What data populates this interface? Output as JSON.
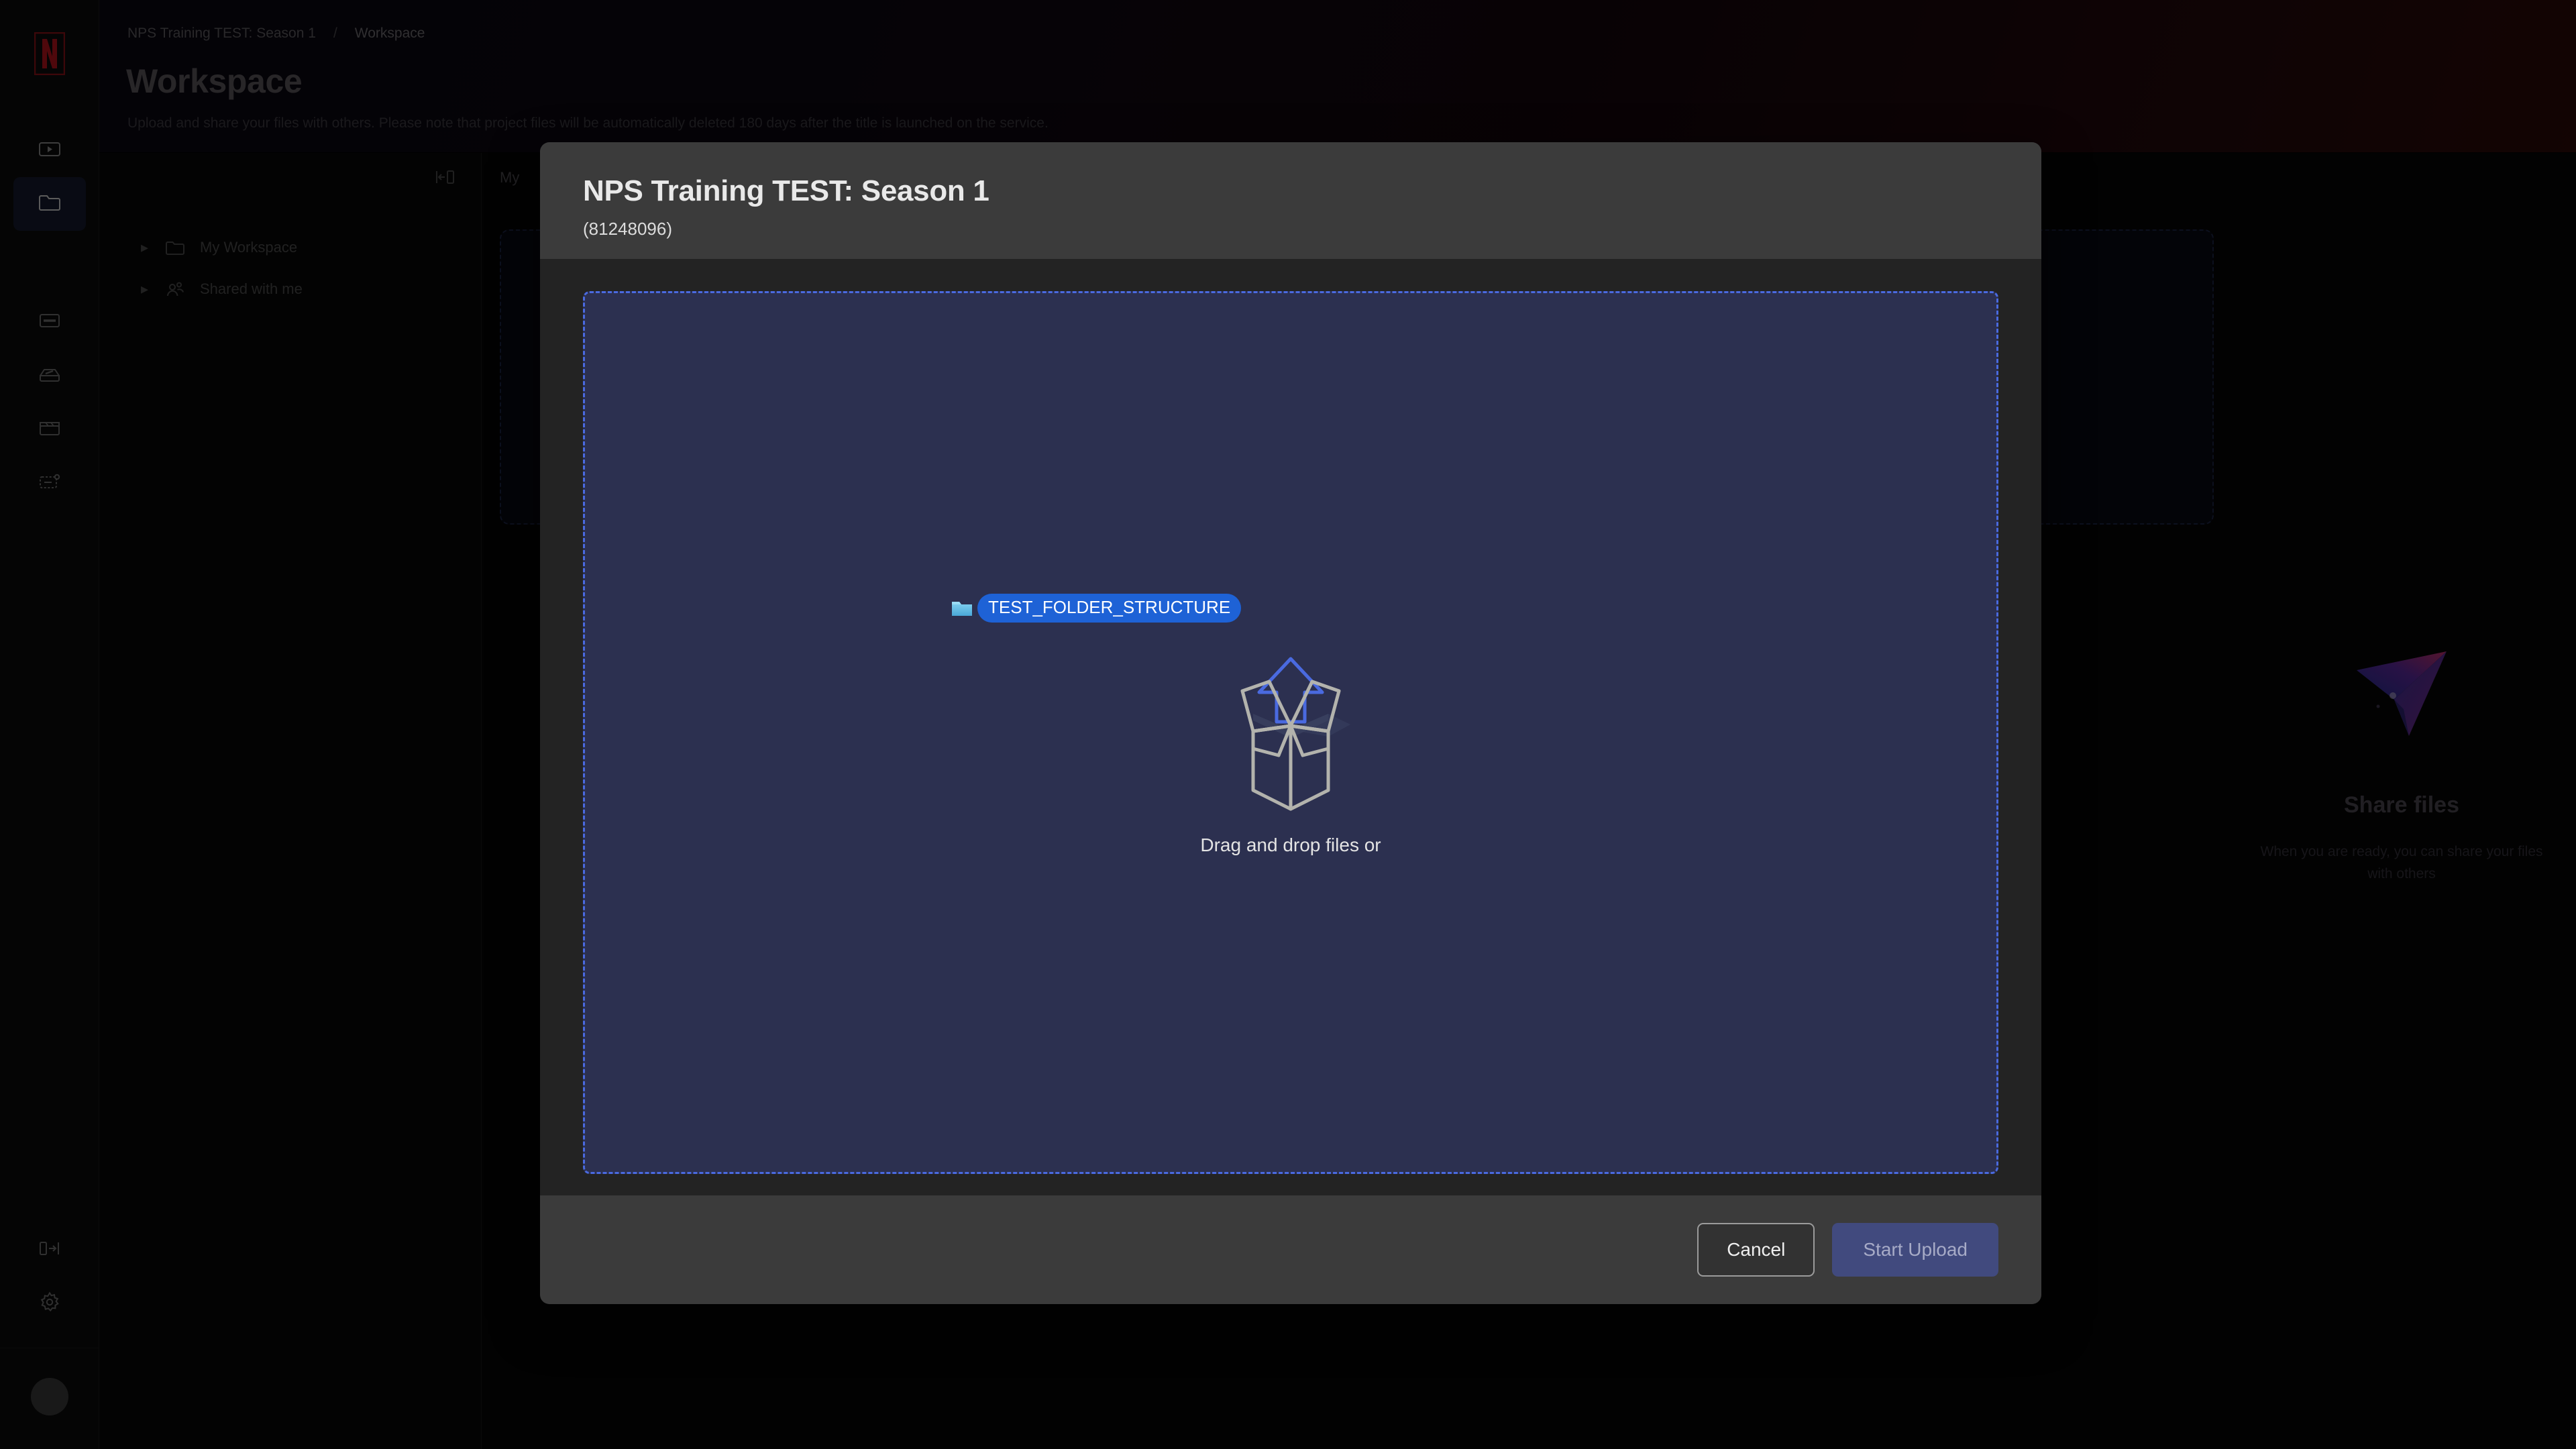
{
  "app": {
    "logo_alt": "netflix-logo",
    "rail_items": [
      {
        "name": "media-player-icon",
        "label": "Media"
      },
      {
        "name": "folder-icon",
        "label": "Workspace",
        "active": true
      },
      {
        "name": "card-icon",
        "label": "Assets"
      },
      {
        "name": "inbox-icon",
        "label": "Inbox"
      },
      {
        "name": "clapperboard-icon",
        "label": "Productions"
      },
      {
        "name": "tasks-icon",
        "label": "Tasks"
      }
    ],
    "rail_bottom": [
      {
        "name": "expand-sidebar-icon",
        "label": "Expand sidebar"
      },
      {
        "name": "gear-icon",
        "label": "Settings"
      }
    ]
  },
  "header": {
    "breadcrumb": {
      "parent": "NPS Training TEST: Season 1",
      "separator": "/",
      "current": "Workspace"
    },
    "title": "Workspace",
    "subtitle": "Upload and share your files with others. Please note that project files will be automatically deleted 180 days after the title is launched on the service."
  },
  "tree": {
    "collapse_icon": "collapse-panel-icon",
    "items": [
      {
        "caret": "▸",
        "icon": "folder-icon",
        "label": "My Workspace"
      },
      {
        "caret": "▸",
        "icon": "shared-users-icon",
        "label": "Shared with me"
      }
    ]
  },
  "content": {
    "tabs": [
      "My"
    ]
  },
  "share_panel": {
    "icon": "paper-plane-icon",
    "title": "Share files",
    "description": "When you are ready, you can share your files with others"
  },
  "modal": {
    "title": "NPS Training TEST: Season 1",
    "subtitle": "(81248096)",
    "dropzone": {
      "icon": "open-box-upload-icon",
      "text": "Drag and drop files or"
    },
    "drag_item": {
      "icon": "folder-icon",
      "label": "TEST_FOLDER_STRUCTURE"
    },
    "buttons": {
      "cancel": "Cancel",
      "start_upload": "Start Upload"
    }
  },
  "colors": {
    "accent_blue": "#4a6ae0",
    "chip_blue": "#1e62d6",
    "dropzone_fill": "#2c3050",
    "modal_surface": "#232323",
    "modal_chrome": "#3b3b3b",
    "upload_button": "#414a7e",
    "brand_red": "#8b1117"
  }
}
